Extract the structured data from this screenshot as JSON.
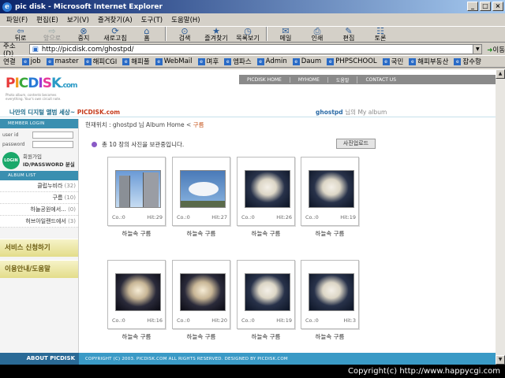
{
  "window": {
    "title": "pic disk - Microsoft Internet Explorer"
  },
  "menu": [
    "파일(F)",
    "편집(E)",
    "보기(V)",
    "즐겨찾기(A)",
    "도구(T)",
    "도움말(H)"
  ],
  "toolbar": [
    {
      "label": "뒤로",
      "icon": "back-arrow-icon",
      "glyph": "⇦"
    },
    {
      "label": "앞으로",
      "icon": "forward-arrow-icon",
      "glyph": "⇨"
    },
    {
      "label": "중지",
      "icon": "stop-icon",
      "glyph": "⊗"
    },
    {
      "label": "새로고침",
      "icon": "refresh-icon",
      "glyph": "⟳"
    },
    {
      "label": "홈",
      "icon": "home-icon",
      "glyph": "⌂"
    },
    {
      "label": "검색",
      "icon": "search-icon",
      "glyph": "⊙"
    },
    {
      "label": "즐겨찾기",
      "icon": "favorites-icon",
      "glyph": "★"
    },
    {
      "label": "목록보기",
      "icon": "history-icon",
      "glyph": "◷"
    },
    {
      "label": "메일",
      "icon": "mail-icon",
      "glyph": "✉"
    },
    {
      "label": "인쇄",
      "icon": "print-icon",
      "glyph": "⎙"
    },
    {
      "label": "편집",
      "icon": "edit-icon",
      "glyph": "✎"
    },
    {
      "label": "토론",
      "icon": "discuss-icon",
      "glyph": "☷"
    }
  ],
  "address": {
    "label": "주소(D)",
    "url": "http://picdisk.com/ghostpd/",
    "go": "이동"
  },
  "links": {
    "label": "연결",
    "items": [
      "job",
      "master",
      "해피CGI",
      "해피풀",
      "WebMail",
      "며후",
      "엠파스",
      "Admin",
      "Daum",
      "PHPSCHOOL",
      "국민",
      "해피부동산",
      "잡수향"
    ]
  },
  "site": {
    "logo_letters": [
      "P",
      "I",
      "C",
      "D",
      "I",
      "S",
      "K"
    ],
    "logo_suffix": ".com",
    "logo_tag": "Photo album, contents becomes everything. Your's own circuit note.",
    "topnav": [
      "PICDISK HOME",
      "MYHOME",
      "도움말",
      "CONTACT US"
    ],
    "slogan_a": "나만의 디지털 앨범 세상~",
    "slogan_b": "PICDISK.com",
    "user": "ghostpd",
    "user_suffix": "님의 My album"
  },
  "sidebar": {
    "member_head": "MEMBER LOGIN",
    "user_id_label": "user id",
    "password_label": "password",
    "login_btn": "LOGIN",
    "join": "회원가입",
    "find": "ID/PASSWORD 분실",
    "album_head": "ALBUM LIST",
    "albums": [
      {
        "name": "클럽누비라",
        "count": "(32)"
      },
      {
        "name": "구름",
        "count": "(10)"
      },
      {
        "name": "하늘공원에서...",
        "count": "(0)"
      },
      {
        "name": "허브아일랜드에서",
        "count": "(3)"
      }
    ],
    "service": "서비스 신청하기",
    "guide": "이용안내/도움말"
  },
  "main": {
    "breadcrumb_prefix": "현재위치 : ghostpd 님 Album Home <",
    "breadcrumb_current": "구름",
    "count_text": "총 10 장의 사진을 보관중입니다.",
    "upload_btn": "사진업로드",
    "photos": [
      {
        "co": "Co.:0",
        "hit": "Hit:29",
        "caption": "하늘속 구름",
        "style": "bld"
      },
      {
        "co": "Co.:0",
        "hit": "Hit:27",
        "caption": "하늘속 구름",
        "style": "sky"
      },
      {
        "co": "Co.:0",
        "hit": "Hit:26",
        "caption": "하늘속 구름",
        "style": "nite"
      },
      {
        "co": "Co.:0",
        "hit": "Hit:19",
        "caption": "하늘속 구름",
        "style": "nite"
      },
      {
        "co": "Co.:0",
        "hit": "Hit:16",
        "caption": "하늘속 구름",
        "style": "dusk"
      },
      {
        "co": "Co.:0",
        "hit": "Hit:20",
        "caption": "하늘속 구름",
        "style": "dusk"
      },
      {
        "co": "Co.:0",
        "hit": "Hit:19",
        "caption": "하늘속 구름",
        "style": "nite"
      },
      {
        "co": "Co.:0",
        "hit": "Hit:3",
        "caption": "하늘속 구름",
        "style": "nite"
      }
    ]
  },
  "footer": {
    "about": "ABOUT PICDISK",
    "copy": "COPYRIGHT (C) 2003. PICDISK.COM ALL RIGHTS RESERVED. DESIGNED BY PICDISK.COM"
  },
  "overlay": {
    "copyright": "Copyright(c) http://www.happycgi.com"
  }
}
